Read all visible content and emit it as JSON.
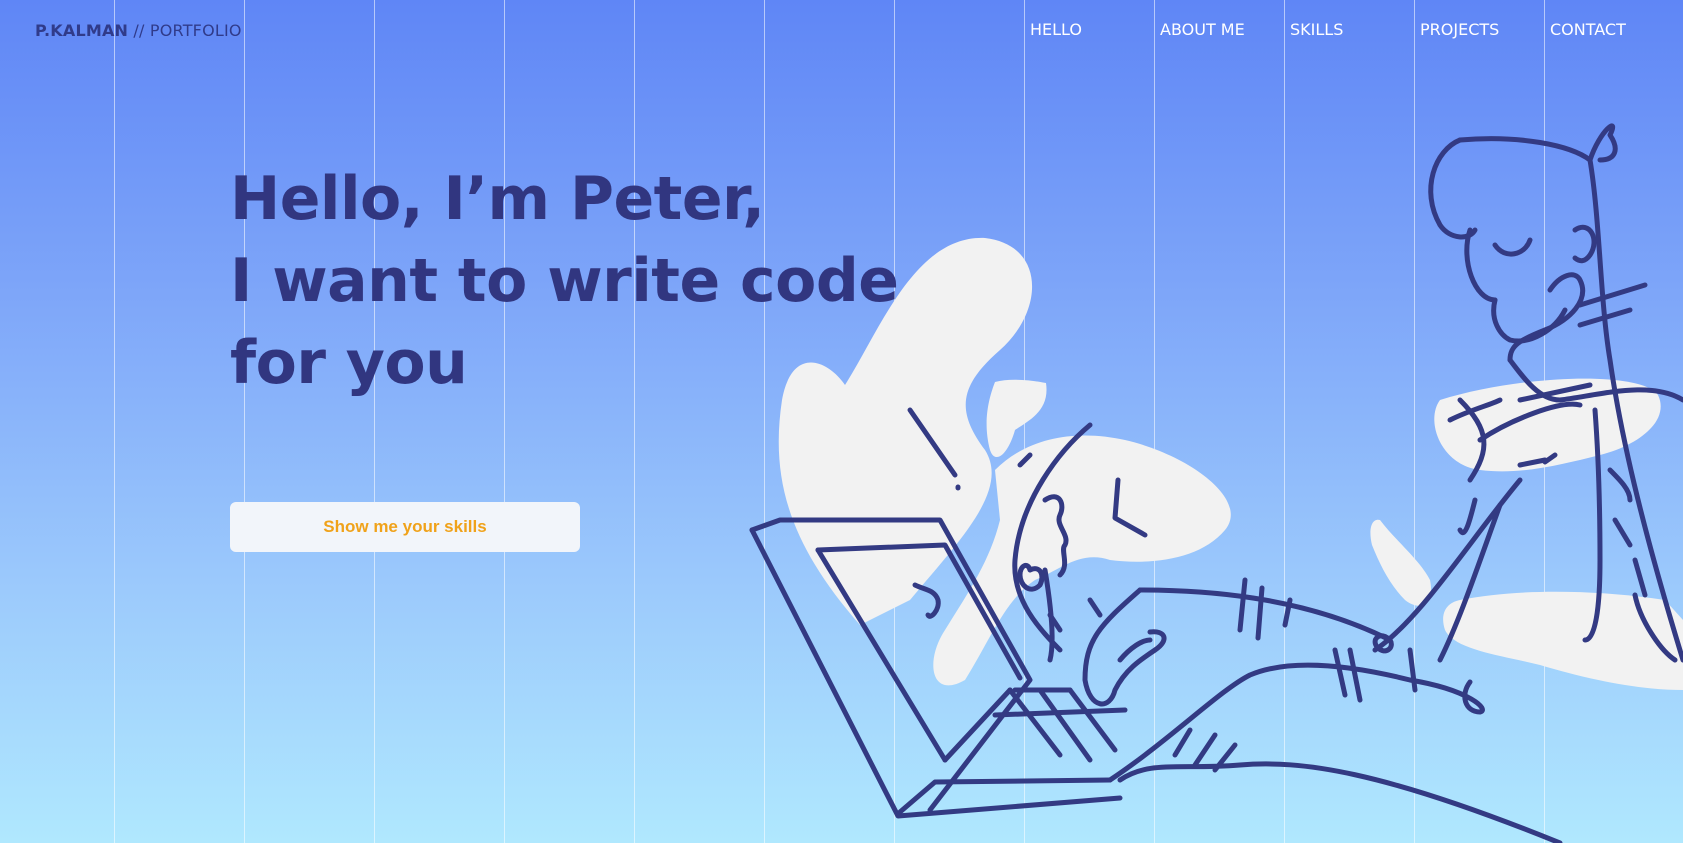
{
  "header": {
    "logo": {
      "name_bold": "P.KALMAN",
      "separator": " // ",
      "subtitle": "PORTFOLIO"
    },
    "nav": [
      {
        "label": "HELLO"
      },
      {
        "label": "ABOUT ME"
      },
      {
        "label": "SKILLS"
      },
      {
        "label": "PROJECTS"
      },
      {
        "label": "CONTACT"
      }
    ]
  },
  "hero": {
    "title_lines": [
      "Hello, I’m Peter,",
      "I want to write code",
      "for you"
    ],
    "cta_label": "Show me your skills"
  },
  "illustration": {
    "description_icon": "person-typing-on-laptop-icon"
  },
  "colors": {
    "gradient_top": "#5f86f6",
    "gradient_bottom": "#b0e8fe",
    "heading": "#313680",
    "nav_text": "#ffffff",
    "cta_background": "#f2f5fa",
    "cta_text": "#f0a21a",
    "blob": "#f2f2f2",
    "line_art": "#333a83"
  }
}
